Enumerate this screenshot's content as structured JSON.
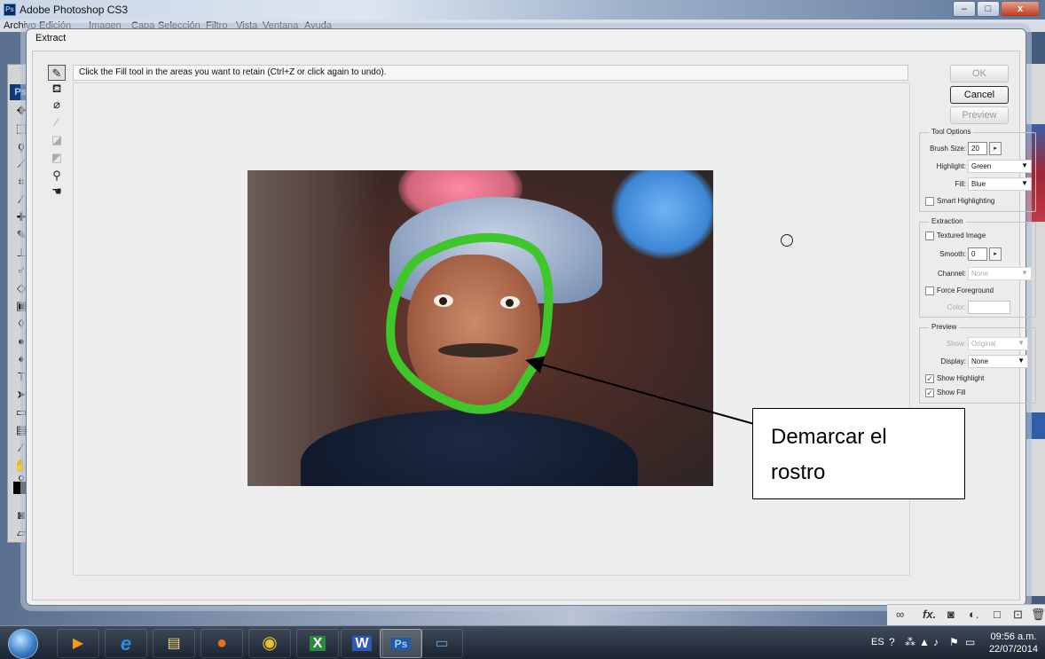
{
  "app": {
    "title": "Adobe Photoshop CS3",
    "logo_text": "Ps",
    "window_buttons": [
      "–",
      "□",
      "x"
    ]
  },
  "menubar": [
    "Archivo",
    "Edición",
    "Imagen",
    "Capa",
    "Selección",
    "Filtro",
    "Vista",
    "Ventana",
    "Ayuda"
  ],
  "toolbox": {
    "badge": "Ps"
  },
  "dialog": {
    "title": "Extract",
    "hint": "Click the Fill tool in the areas you want to retain (Ctrl+Z or click again to undo).",
    "tools": [
      {
        "name": "edge-highlighter-icon",
        "glyph": "✎",
        "selected": true,
        "disabled": false
      },
      {
        "name": "fill-icon",
        "glyph": "◈",
        "selected": false,
        "disabled": false
      },
      {
        "name": "eraser-icon",
        "glyph": "⌫",
        "selected": false,
        "disabled": false
      },
      {
        "name": "eyedropper-icon",
        "glyph": "⁄",
        "selected": false,
        "disabled": true
      },
      {
        "name": "cleanup-icon",
        "glyph": "◪",
        "selected": false,
        "disabled": true
      },
      {
        "name": "edge-touchup-icon",
        "glyph": "◩",
        "selected": false,
        "disabled": true
      },
      {
        "name": "zoom-icon",
        "glyph": "🔍",
        "selected": false,
        "disabled": false
      },
      {
        "name": "hand-icon",
        "glyph": "✋",
        "selected": false,
        "disabled": false
      }
    ],
    "buttons": {
      "ok": "OK",
      "cancel": "Cancel",
      "preview": "Preview"
    },
    "tool_options": {
      "title": "Tool Options",
      "brush_size_label": "Brush Size:",
      "brush_size": "20",
      "highlight_label": "Highlight:",
      "highlight": "Green",
      "fill_label": "Fill:",
      "fill": "Blue",
      "smart_highlighting_label": "Smart Highlighting",
      "smart_highlighting": false
    },
    "extraction": {
      "title": "Extraction",
      "textured_image_label": "Textured Image",
      "textured_image": false,
      "smooth_label": "Smooth:",
      "smooth": "0",
      "channel_label": "Channel:",
      "channel": "None",
      "force_foreground_label": "Force Foreground",
      "force_foreground": false,
      "color_label": "Color:"
    },
    "preview": {
      "title": "Preview",
      "show_label": "Show:",
      "show": "Original",
      "display_label": "Display:",
      "display": "None",
      "show_highlight_label": "Show Highlight",
      "show_highlight": true,
      "show_fill_label": "Show Fill",
      "show_fill": true
    },
    "colors": {
      "highlight_stroke": "#3fc62a"
    }
  },
  "callout": {
    "line1": "Demarcar el",
    "line2": "rostro"
  },
  "status_strip": [
    "∞",
    "fx.",
    "◙",
    "◐.",
    "□",
    "⊡",
    "🗑"
  ],
  "taskbar": {
    "apps": [
      {
        "name": "media-player-icon",
        "glyph": "▶",
        "color": "#f39a1e"
      },
      {
        "name": "internet-explorer-icon",
        "glyph": "e",
        "color": "#2d8ee0"
      },
      {
        "name": "file-explorer-icon",
        "glyph": "▤",
        "color": "#f2d27a"
      },
      {
        "name": "firefox-icon",
        "glyph": "●",
        "color": "#e5701e"
      },
      {
        "name": "chrome-icon",
        "glyph": "◉",
        "color": "#e8c02a"
      },
      {
        "name": "excel-icon",
        "glyph": "X",
        "color": "#2a8a3b"
      },
      {
        "name": "word-icon",
        "glyph": "W",
        "color": "#2b5bb5"
      },
      {
        "name": "photoshop-icon",
        "glyph": "Ps",
        "color": "#1e5aa8"
      },
      {
        "name": "remote-desktop-icon",
        "glyph": "▭",
        "color": "#6aa5dc"
      }
    ],
    "language": "ES",
    "time": "09:56 a.m.",
    "date": "22/07/2014"
  }
}
